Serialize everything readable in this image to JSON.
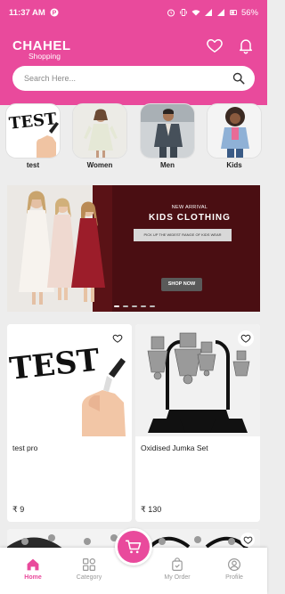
{
  "status_bar": {
    "time": "11:37 AM",
    "battery": "56%"
  },
  "header": {
    "brand_name": "CHAHEL",
    "brand_sub": "Shopping",
    "background": "#e94a9c",
    "icons": [
      "heart-icon",
      "bell-icon"
    ]
  },
  "search": {
    "placeholder": "Search Here...",
    "value": ""
  },
  "categories": [
    {
      "label": "test"
    },
    {
      "label": "Women"
    },
    {
      "label": "Men"
    },
    {
      "label": "Kids"
    }
  ],
  "banner": {
    "tag": "NEW ARRIVAL",
    "title": "KIDS CLOTHING",
    "subtitle": "PICK UP THE WIDEST RANGE OF KIDS WEAR",
    "cta": "SHOP NOW",
    "slides": 5,
    "active_slide": 1
  },
  "products": [
    {
      "name": "test pro",
      "price": "₹ 9",
      "image_text": "TEST"
    },
    {
      "name": "Oxidised Jumka Set",
      "price": "₹ 130"
    }
  ],
  "bottom_nav": {
    "items": [
      {
        "label": "Home",
        "active": true
      },
      {
        "label": "Category",
        "active": false
      },
      {
        "label": "My Order",
        "active": false
      },
      {
        "label": "Profile",
        "active": false
      }
    ],
    "accent": "#e94a9c"
  }
}
